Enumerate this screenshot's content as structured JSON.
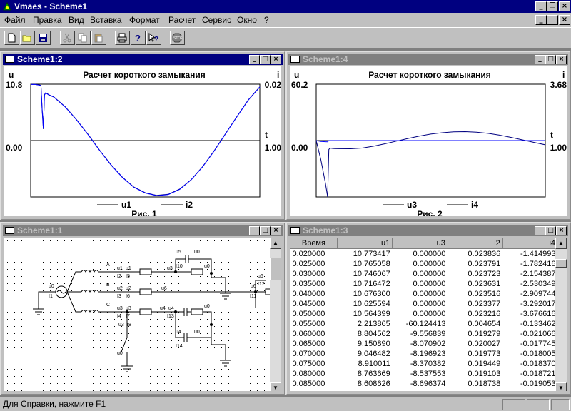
{
  "app": {
    "title": "Vmaes - Scheme1"
  },
  "menu": [
    "Файл",
    "Правка",
    "Вид",
    "Вставка",
    "Формат",
    "Расчет",
    "Сервис",
    "Окно",
    "?"
  ],
  "toolbar": {
    "icons": [
      "new-file-icon",
      "open-folder-icon",
      "save-icon",
      "cut-icon",
      "copy-icon",
      "paste-icon",
      "print-icon",
      "help-icon",
      "context-help-icon",
      "stop-icon"
    ]
  },
  "windows": {
    "chart1": {
      "title": "Scheme1:2"
    },
    "chart2": {
      "title": "Scheme1:4"
    },
    "schematic": {
      "title": "Scheme1:1"
    },
    "table": {
      "title": "Scheme1:3"
    }
  },
  "chart_data": [
    {
      "type": "line",
      "title": "Расчет короткого замыкания",
      "caption": "Рис. 1",
      "left_axis_label": "u",
      "right_axis_label": "i",
      "x_axis_label": "t",
      "left_ylim_labels": [
        "10.8",
        "0.00"
      ],
      "right_ylim_labels": [
        "0.02",
        "1.00"
      ],
      "left_ylim": [
        -10.8,
        10.8
      ],
      "right_ylim": [
        -0.02,
        0.02
      ],
      "xlim": [
        0,
        1
      ],
      "x": [
        0,
        0.02,
        0.04,
        0.045,
        0.05,
        0.055,
        0.06,
        0.065,
        0.07,
        0.08,
        0.1,
        0.15,
        0.2,
        0.25,
        0.3,
        0.35,
        0.4,
        0.45,
        0.5,
        0.55,
        0.6,
        0.65,
        0.7,
        0.75,
        0.8,
        0.85,
        0.9,
        0.95,
        1.0
      ],
      "series": [
        {
          "name": "u1",
          "axis": "left",
          "values": [
            10.77,
            10.76,
            10.63,
            10.56,
            6.0,
            2.21,
            8.8,
            9.15,
            9.05,
            8.76,
            8.4,
            6.5,
            4.0,
            1.2,
            -1.8,
            -4.6,
            -7.0,
            -8.9,
            -10.0,
            -10.5,
            -10.3,
            -9.3,
            -7.5,
            -5.0,
            -2.0,
            1.3,
            4.6,
            7.8,
            10.3
          ]
        },
        {
          "name": "i2",
          "axis": "left",
          "values": [
            10.75,
            10.74,
            10.6,
            10.53,
            6.1,
            2.3,
            8.7,
            9.1,
            9.0,
            8.7,
            8.35,
            6.45,
            3.95,
            1.15,
            -1.85,
            -4.65,
            -7.05,
            -8.95,
            -10.05,
            -10.55,
            -10.35,
            -9.35,
            -7.55,
            -5.05,
            -2.05,
            1.25,
            4.55,
            7.75,
            10.25
          ]
        }
      ]
    },
    {
      "type": "line",
      "title": "Расчет короткого замыкания",
      "caption": "Рис. 2",
      "left_axis_label": "u",
      "right_axis_label": "i",
      "x_axis_label": "t",
      "left_ylim_labels": [
        "60.2",
        "0.00"
      ],
      "right_ylim_labels": [
        "3.68",
        "1.00"
      ],
      "left_ylim": [
        -60.2,
        60.2
      ],
      "right_ylim": [
        -3.68,
        3.68
      ],
      "xlim": [
        0,
        1
      ],
      "x": [
        0,
        0.02,
        0.04,
        0.05,
        0.055,
        0.06,
        0.065,
        0.07,
        0.08,
        0.1,
        0.15,
        0.2,
        0.25,
        0.3,
        0.35,
        0.4,
        0.45,
        0.5,
        0.55,
        0.6,
        0.65,
        0.7,
        0.75,
        0.8,
        0.85,
        0.9,
        0.95,
        1.0
      ],
      "series": [
        {
          "name": "u3",
          "axis": "left",
          "values": [
            0,
            -20,
            -45,
            -60.1,
            -9.56,
            -8.07,
            -8.2,
            -8.37,
            -8.54,
            -8.7,
            -8.8,
            -8.0,
            -6.0,
            -3.4,
            -0.6,
            2.2,
            4.8,
            6.9,
            8.4,
            9.3,
            9.5,
            9.0,
            7.7,
            5.8,
            3.4,
            0.8,
            -1.9,
            -4.5
          ]
        },
        {
          "name": "i4",
          "axis": "left",
          "values": [
            0,
            -1.0,
            -1.2,
            -1.3,
            0,
            0,
            0,
            0,
            0,
            0,
            0,
            0,
            0,
            0,
            0,
            0,
            0,
            0,
            0,
            0,
            0,
            0,
            0,
            0,
            0,
            0,
            0,
            0
          ]
        }
      ]
    }
  ],
  "schematic": {
    "labels": [
      "u5",
      "u0",
      "I10",
      "A",
      "u1",
      "u1",
      "I2",
      "I5",
      "u3",
      "u0",
      "u6",
      "u6",
      "I12",
      "u0",
      "I1",
      "B",
      "u2",
      "u2",
      "I3",
      "I6",
      "u6",
      "I11",
      "C",
      "u3",
      "u3",
      "I4",
      "I7",
      "u4",
      "u4",
      "I13",
      "u0",
      "u3",
      "I8",
      "u4",
      "u0",
      "I14",
      "u0"
    ]
  },
  "table": {
    "columns": [
      "Время",
      "u1",
      "u3",
      "i2",
      "i4"
    ],
    "rows": [
      [
        "0.020000",
        "10.773417",
        "0.000000",
        "0.023836",
        "-1.414993"
      ],
      [
        "0.025000",
        "10.765058",
        "0.000000",
        "0.023791",
        "-1.782416"
      ],
      [
        "0.030000",
        "10.746067",
        "0.000000",
        "0.023723",
        "-2.154387"
      ],
      [
        "0.035000",
        "10.716472",
        "0.000000",
        "0.023631",
        "-2.530349"
      ],
      [
        "0.040000",
        "10.676300",
        "0.000000",
        "0.023516",
        "-2.909744"
      ],
      [
        "0.045000",
        "10.625594",
        "0.000000",
        "0.023377",
        "-3.292017"
      ],
      [
        "0.050000",
        "10.564399",
        "0.000000",
        "0.023216",
        "-3.676616"
      ],
      [
        "0.055000",
        "2.213865",
        "-60.124413",
        "0.004654",
        "-0.133462"
      ],
      [
        "0.060000",
        "8.804562",
        "-9.556839",
        "0.019279",
        "-0.021066"
      ],
      [
        "0.065000",
        "9.150890",
        "-8.070902",
        "0.020027",
        "-0.017745"
      ],
      [
        "0.070000",
        "9.046482",
        "-8.196923",
        "0.019773",
        "-0.018005"
      ],
      [
        "0.075000",
        "8.910011",
        "-8.370382",
        "0.019449",
        "-0.018370"
      ],
      [
        "0.080000",
        "8.763669",
        "-8.537553",
        "0.019103",
        "-0.018721"
      ],
      [
        "0.085000",
        "8.608626",
        "-8.696374",
        "0.018738",
        "-0.019053"
      ]
    ]
  },
  "status": {
    "text": "Для Справки, нажмите F1"
  }
}
